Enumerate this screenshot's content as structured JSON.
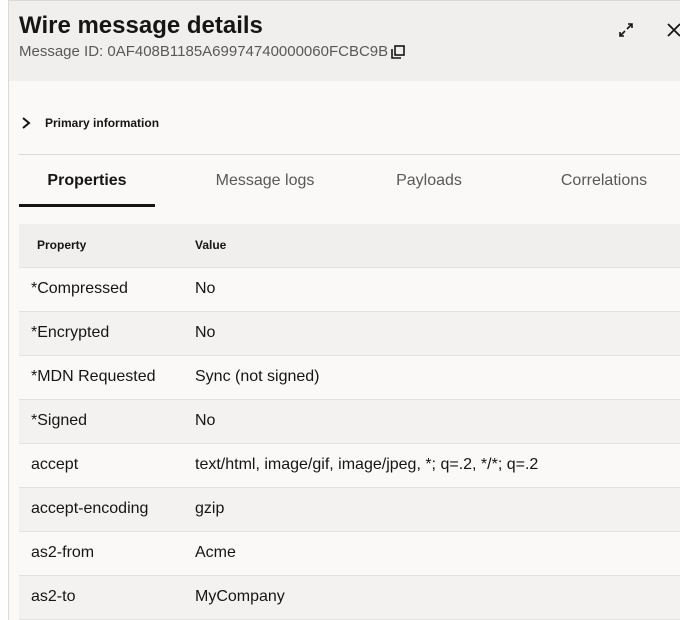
{
  "header": {
    "title": "Wire message details",
    "message_id": "Message ID: 0AF408B1185A69974740000060FCBC9B"
  },
  "icons": {
    "copy": "copy-icon",
    "expand": "expand-icon",
    "close": "close-icon",
    "chevron": "chevron-right-icon"
  },
  "section": {
    "primary_label": "Primary information"
  },
  "tabs": [
    {
      "label": "Properties",
      "active": true
    },
    {
      "label": "Message logs",
      "active": false
    },
    {
      "label": "Payloads",
      "active": false
    },
    {
      "label": "Correlations",
      "active": false
    }
  ],
  "table": {
    "columns": [
      "Property",
      "Value"
    ],
    "rows": [
      [
        "*Compressed",
        "No"
      ],
      [
        "*Encrypted",
        "No"
      ],
      [
        "*MDN Requested",
        "Sync (not signed)"
      ],
      [
        "*Signed",
        "No"
      ],
      [
        "accept",
        "text/html, image/gif, image/jpeg, *; q=.2, */*; q=.2"
      ],
      [
        "accept-encoding",
        "gzip"
      ],
      [
        "as2-from",
        "Acme"
      ],
      [
        "as2-to",
        "MyCompany"
      ]
    ]
  }
}
